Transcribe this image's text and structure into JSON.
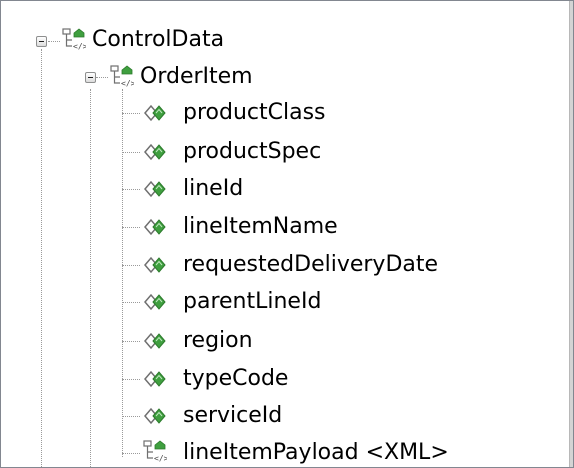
{
  "tree": {
    "root": {
      "label": "ControlData",
      "icon": "complex-element-icon",
      "expanded": true
    },
    "order_item": {
      "label": "OrderItem",
      "icon": "complex-element-icon",
      "expanded": true
    },
    "children": [
      {
        "label": "productClass",
        "icon": "simple-element-icon"
      },
      {
        "label": "productSpec",
        "icon": "simple-element-icon"
      },
      {
        "label": "lineId",
        "icon": "simple-element-icon"
      },
      {
        "label": "lineItemName",
        "icon": "simple-element-icon"
      },
      {
        "label": "requestedDeliveryDate",
        "icon": "simple-element-icon"
      },
      {
        "label": "parentLineId",
        "icon": "simple-element-icon"
      },
      {
        "label": "region",
        "icon": "simple-element-icon"
      },
      {
        "label": "typeCode",
        "icon": "simple-element-icon"
      },
      {
        "label": "serviceId",
        "icon": "simple-element-icon"
      },
      {
        "label": "lineItemPayload <XML>",
        "icon": "complex-element-icon"
      }
    ]
  },
  "colors": {
    "tree_line": "#9a9a9a",
    "icon_green": "#3f9f3f",
    "icon_gray": "#6f6f6f"
  }
}
